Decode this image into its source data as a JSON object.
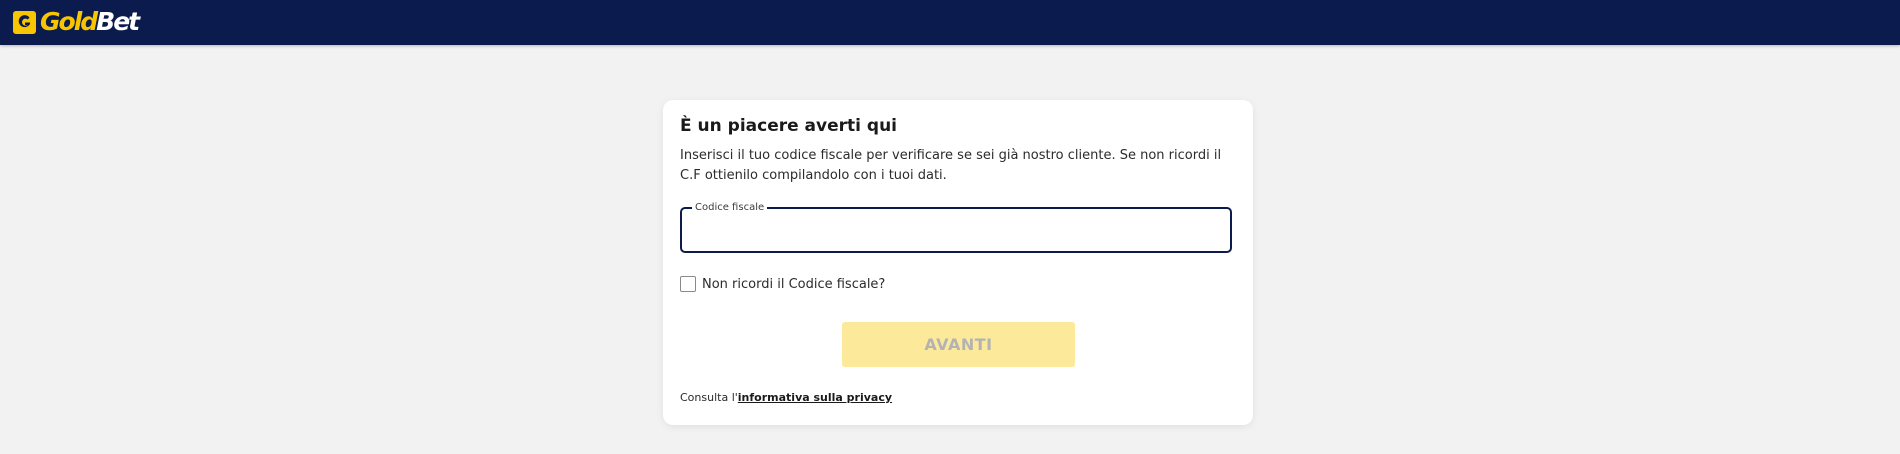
{
  "header": {
    "logo_part1": "Gold",
    "logo_part2": "Bet",
    "logo_badge": "G",
    "background_color": "#0c1b4d",
    "brand_color": "#f7c600"
  },
  "card": {
    "title": "È un piacere averti qui",
    "description": "Inserisci il tuo codice fiscale per verificare se sei già nostro cliente. Se non ricordi il C.F ottienilo compilandolo con i tuoi dati.",
    "field": {
      "label": "Codice fiscale",
      "value": ""
    },
    "checkbox": {
      "label": "Non ricordi il Codice fiscale?",
      "checked": false
    },
    "submit_label": "AVANTI",
    "privacy": {
      "prefix": "Consulta l'",
      "link_text": "informativa sulla privacy"
    }
  }
}
